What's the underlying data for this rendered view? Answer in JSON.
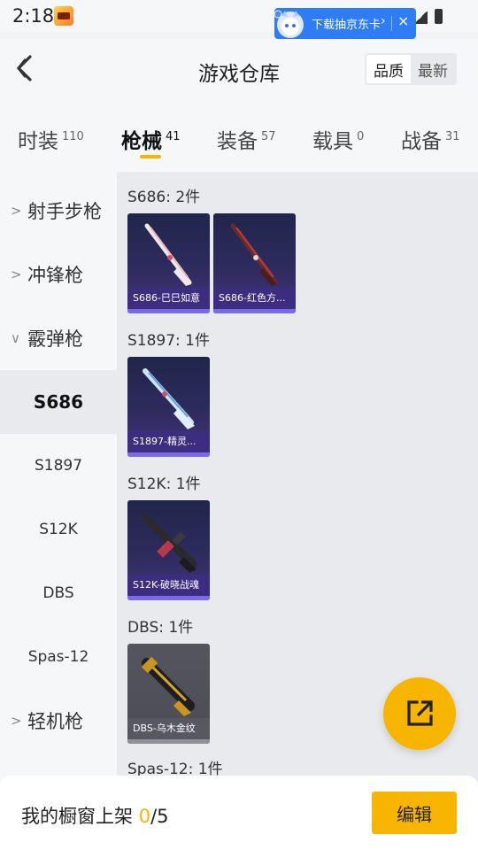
{
  "status_bar": {
    "time": "2:18"
  },
  "ad": {
    "text": "下载抽京东卡",
    "chevron": "›",
    "close": "×"
  },
  "header": {
    "title": "游戏仓库",
    "sort_options": [
      "品质",
      "最新"
    ],
    "active_sort": "品质"
  },
  "tabs": [
    {
      "label": "时装",
      "count": "110"
    },
    {
      "label": "枪械",
      "count": "41",
      "active": true
    },
    {
      "label": "装备",
      "count": "57"
    },
    {
      "label": "载具",
      "count": "0"
    },
    {
      "label": "战备",
      "count": "31"
    }
  ],
  "sidebar": {
    "items": [
      {
        "label": "射手步枪",
        "type": "category",
        "expanded": false
      },
      {
        "label": "冲锋枪",
        "type": "category",
        "expanded": false
      },
      {
        "label": "霰弹枪",
        "type": "category",
        "expanded": true
      },
      {
        "label": "S686",
        "type": "sub",
        "selected": true
      },
      {
        "label": "S1897",
        "type": "sub"
      },
      {
        "label": "S12K",
        "type": "sub"
      },
      {
        "label": "DBS",
        "type": "sub"
      },
      {
        "label": "Spas-12",
        "type": "sub"
      },
      {
        "label": "轻机枪",
        "type": "category",
        "expanded": false
      }
    ]
  },
  "sections": [
    {
      "title": "S686: 2件",
      "items": [
        "S686-巳巳如意",
        "S686-红色方..."
      ]
    },
    {
      "title": "S1897: 1件",
      "items": [
        "S1897-精灵..."
      ]
    },
    {
      "title": "S12K: 1件",
      "items": [
        "S12K-破晓战魂"
      ]
    },
    {
      "title": "DBS: 1件",
      "items": [
        "DBS-乌木金纹"
      ]
    },
    {
      "title": "Spas-12: 1件",
      "items": []
    }
  ],
  "bottom": {
    "label": "我的橱窗上架 ",
    "shelved": "0",
    "total": "/5",
    "edit_label": "编辑"
  },
  "colors": {
    "accent": "#f7b500",
    "card_purple": "#2e2b5e",
    "card_bar": "#7b6ae8"
  },
  "icons": {
    "back": "chevron-left-icon",
    "fab": "share-external-icon"
  }
}
